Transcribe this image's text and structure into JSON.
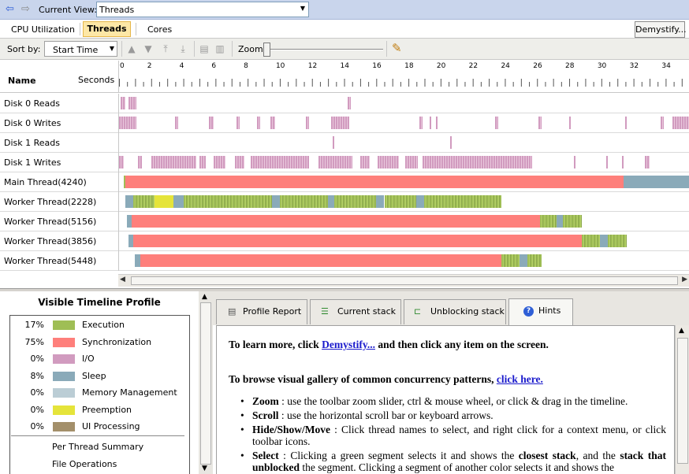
{
  "viewbar": {
    "label": "Current View:",
    "value": "Threads"
  },
  "tabs": [
    {
      "label": "CPU Utilization"
    },
    {
      "label": "Threads"
    },
    {
      "label": "Cores"
    }
  ],
  "demystify_label": "Demystify...",
  "toolbar": {
    "sort_label": "Sort by:",
    "sort_value": "Start Time",
    "zoom_label": "Zoom"
  },
  "header": {
    "name": "Name",
    "seconds": "Seconds"
  },
  "ruler_ticks": [
    "0",
    "2",
    "4",
    "6",
    "8",
    "10",
    "12",
    "14",
    "16",
    "18",
    "20",
    "22",
    "24",
    "26",
    "28",
    "30",
    "32",
    "34"
  ],
  "ruler_range": [
    0,
    35.5
  ],
  "colors": {
    "execution": "#9fbe55",
    "synchronization": "#fe7f7b",
    "io": "#d19bbf",
    "sleep": "#8aaab9",
    "memory": "#bbcdd5",
    "preemption": "#e5e43a",
    "ui": "#a38f6a"
  },
  "rows": [
    {
      "label": "Disk 0 Reads",
      "segments": [
        [
          0.1,
          0.4,
          "io"
        ],
        [
          0.6,
          1.1,
          "io"
        ],
        [
          14.2,
          14.4,
          "io"
        ]
      ]
    },
    {
      "label": "Disk 0 Writes",
      "segments": [
        [
          0,
          1.1,
          "io"
        ],
        [
          3.5,
          3.7,
          "io"
        ],
        [
          5.6,
          5.9,
          "io"
        ],
        [
          7.3,
          7.5,
          "io"
        ],
        [
          8.6,
          8.8,
          "io"
        ],
        [
          9.4,
          9.7,
          "io"
        ],
        [
          11.6,
          11.8,
          "io"
        ],
        [
          13.2,
          14.3,
          "io"
        ],
        [
          18.7,
          18.9,
          "io"
        ],
        [
          19.3,
          19.4,
          "io"
        ],
        [
          19.7,
          19.8,
          "io"
        ],
        [
          23.4,
          23.6,
          "io"
        ],
        [
          26.1,
          26.3,
          "io"
        ],
        [
          28.0,
          28.1,
          "io"
        ],
        [
          31.5,
          31.6,
          "io"
        ],
        [
          33.7,
          33.9,
          "io"
        ],
        [
          34.4,
          35.5,
          "io"
        ]
      ]
    },
    {
      "label": "Disk 1 Reads",
      "segments": [
        [
          13.3,
          13.4,
          "io"
        ],
        [
          20.6,
          20.7,
          "io"
        ]
      ]
    },
    {
      "label": "Disk 1 Writes",
      "segments": [
        [
          0,
          0.3,
          "io"
        ],
        [
          1.2,
          1.4,
          "io"
        ],
        [
          2.0,
          4.8,
          "io"
        ],
        [
          5.0,
          5.4,
          "io"
        ],
        [
          5.9,
          6.6,
          "io"
        ],
        [
          7.2,
          7.8,
          "io"
        ],
        [
          8.2,
          11.8,
          "io"
        ],
        [
          12.4,
          14.5,
          "io"
        ],
        [
          15.0,
          15.6,
          "io"
        ],
        [
          16.1,
          17.4,
          "io"
        ],
        [
          17.8,
          18.6,
          "io"
        ],
        [
          18.9,
          25.7,
          "io"
        ],
        [
          28.3,
          28.4,
          "io"
        ],
        [
          30.3,
          30.4,
          "io"
        ],
        [
          31.3,
          31.4,
          "io"
        ],
        [
          32.7,
          33.0,
          "io"
        ]
      ]
    },
    {
      "label": "Main Thread(4240)",
      "segments": [
        [
          0.3,
          0.4,
          "execution"
        ],
        [
          0.4,
          31.4,
          "synchronization"
        ],
        [
          31.4,
          35.5,
          "sleep"
        ]
      ]
    },
    {
      "label": "Worker Thread(2228)",
      "segments": [
        [
          0.4,
          0.9,
          "sleep"
        ],
        [
          0.9,
          2.2,
          "execution"
        ],
        [
          2.2,
          3.4,
          "preemption"
        ],
        [
          3.4,
          4.0,
          "sleep"
        ],
        [
          4.0,
          9.5,
          "execution"
        ],
        [
          9.5,
          10.0,
          "sleep"
        ],
        [
          10.0,
          13.0,
          "execution"
        ],
        [
          13.0,
          13.4,
          "sleep"
        ],
        [
          13.4,
          16.0,
          "execution"
        ],
        [
          16.0,
          16.5,
          "sleep"
        ],
        [
          16.5,
          18.5,
          "execution"
        ],
        [
          18.5,
          19.0,
          "sleep"
        ],
        [
          19.0,
          23.8,
          "execution"
        ]
      ]
    },
    {
      "label": "Worker Thread(5156)",
      "segments": [
        [
          0.5,
          0.8,
          "sleep"
        ],
        [
          0.8,
          26.2,
          "synchronization"
        ],
        [
          26.2,
          27.2,
          "execution"
        ],
        [
          27.2,
          27.6,
          "sleep"
        ],
        [
          27.6,
          28.8,
          "execution"
        ]
      ]
    },
    {
      "label": "Worker Thread(3856)",
      "segments": [
        [
          0.6,
          0.9,
          "sleep"
        ],
        [
          0.9,
          28.8,
          "synchronization"
        ],
        [
          28.8,
          29.9,
          "execution"
        ],
        [
          29.9,
          30.4,
          "sleep"
        ],
        [
          30.4,
          31.6,
          "execution"
        ]
      ]
    },
    {
      "label": "Worker Thread(5448)",
      "segments": [
        [
          1.0,
          1.3,
          "sleep"
        ],
        [
          1.3,
          23.8,
          "synchronization"
        ],
        [
          23.8,
          24.9,
          "execution"
        ],
        [
          24.9,
          25.4,
          "sleep"
        ],
        [
          25.4,
          26.3,
          "execution"
        ]
      ]
    }
  ],
  "profile": {
    "title": "Visible Timeline Profile",
    "items": [
      {
        "pct": "17%",
        "name": "Execution",
        "color": "#9fbe55"
      },
      {
        "pct": "75%",
        "name": "Synchronization",
        "color": "#fe7f7b"
      },
      {
        "pct": "0%",
        "name": "I/O",
        "color": "#d19bbf"
      },
      {
        "pct": "8%",
        "name": "Sleep",
        "color": "#8aaab9"
      },
      {
        "pct": "0%",
        "name": "Memory Management",
        "color": "#bbcdd5"
      },
      {
        "pct": "0%",
        "name": "Preemption",
        "color": "#e5e43a"
      },
      {
        "pct": "0%",
        "name": "UI Processing",
        "color": "#a38f6a"
      }
    ],
    "links": [
      "Per Thread Summary",
      "File Operations"
    ]
  },
  "panel_tabs": [
    {
      "label": "Profile Report",
      "icon": "report-icon"
    },
    {
      "label": "Current stack",
      "icon": "stack-icon"
    },
    {
      "label": "Unblocking stack",
      "icon": "unblock-stack-icon"
    },
    {
      "label": "Hints",
      "icon": "help-icon"
    }
  ],
  "hints": {
    "line1_pre": "To learn more, click ",
    "line1_link": "Demystify...",
    "line1_post": " and then click any item on the screen.",
    "line2_pre": "To browse visual gallery of common concurrency patterns, ",
    "line2_link": "click here.",
    "bullets": [
      {
        "bold": "Zoom",
        "text": " : use the toolbar zoom slider, ctrl & mouse wheel, or click & drag in the timeline."
      },
      {
        "bold": "Scroll",
        "text": " : use the horizontal scroll bar or keyboard arrows."
      },
      {
        "bold": "Hide/Show/Move",
        "text": " : Click thread names to select, and right click for a context menu, or click toolbar icons."
      },
      {
        "bold": "Select",
        "text": " : Clicking a green segment selects it and shows the ",
        "bold2": "closest stack",
        "text2": ", and the ",
        "bold3": "stack that unblocked",
        "text3": " the segment. Clicking a segment of another color selects it and shows the"
      }
    ]
  }
}
